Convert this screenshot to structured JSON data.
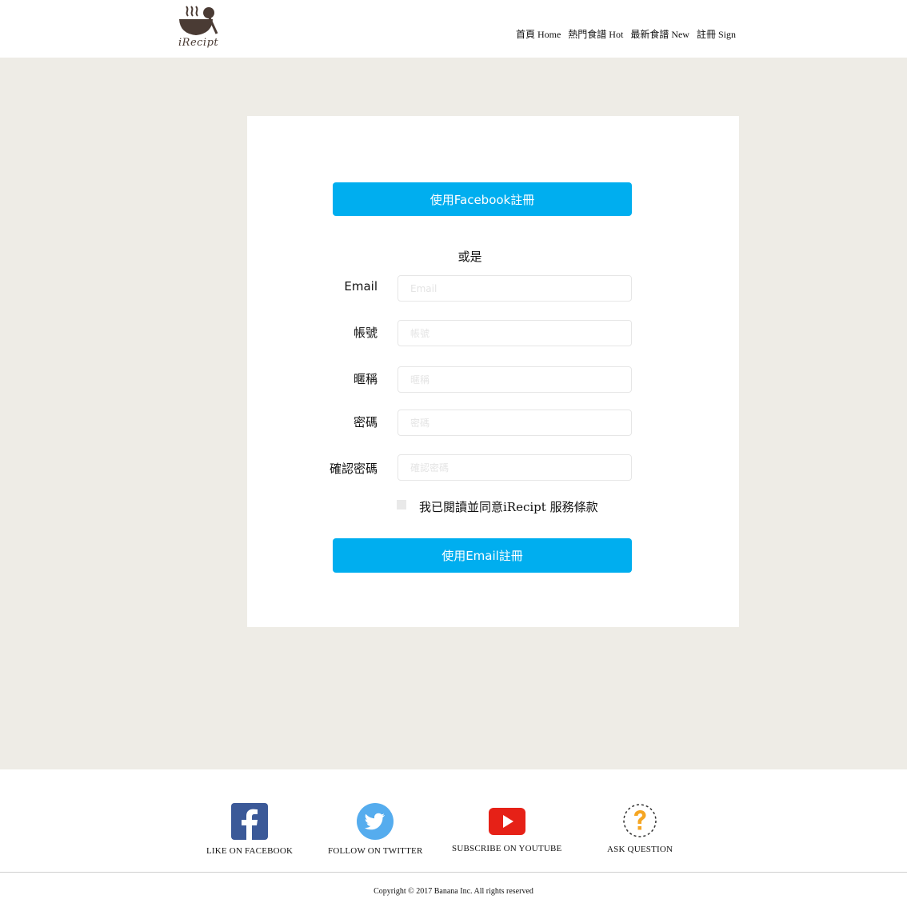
{
  "header": {
    "logo_text": "iRecipt",
    "nav": [
      {
        "label": "首頁 Home"
      },
      {
        "label": "熱門食譜 Hot"
      },
      {
        "label": "最新食譜 New"
      },
      {
        "label": "註冊 Sign"
      }
    ]
  },
  "form": {
    "facebook_button": "使用Facebook註冊",
    "or_text": "或是",
    "fields": [
      {
        "label": "Email",
        "placeholder": "Email",
        "value": ""
      },
      {
        "label": "帳號",
        "placeholder": "帳號",
        "value": ""
      },
      {
        "label": "暱稱",
        "placeholder": "暱稱",
        "value": ""
      },
      {
        "label": "密碼",
        "placeholder": "密碼",
        "value": ""
      },
      {
        "label": "確認密碼",
        "placeholder": "確認密碼",
        "value": ""
      }
    ],
    "agree_text": "我已閱讀並同意iRecipt 服務條款",
    "agree_checked": false,
    "email_button": "使用Email註冊"
  },
  "footer": {
    "social": [
      {
        "label": "LIKE ON FACEBOOK",
        "icon": "facebook-icon",
        "color": "#3b5998"
      },
      {
        "label": "FOLLOW ON TWITTER",
        "icon": "twitter-icon",
        "color": "#55acee"
      },
      {
        "label": "SUBSCRIBE ON YOUTUBE",
        "icon": "youtube-icon",
        "color": "#e62117"
      },
      {
        "label": "ASK QUESTION",
        "icon": "question-icon",
        "color": "#f5a623"
      }
    ],
    "copyright": "Copyright © 2017 Banana Inc. All rights reserved"
  },
  "colors": {
    "accent": "#00aeef",
    "background": "#eeece6"
  }
}
